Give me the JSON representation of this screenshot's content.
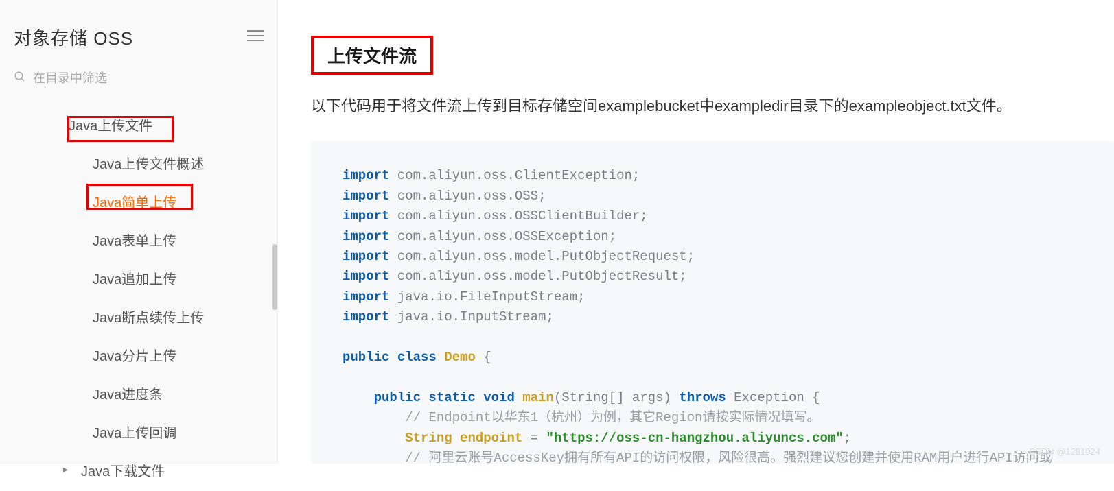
{
  "sidebar": {
    "title": "对象存储 OSS",
    "search_placeholder": "在目录中筛选",
    "items": [
      {
        "label": "Java上传文件",
        "class": "nav-item"
      },
      {
        "label": "Java上传文件概述",
        "class": "nav-item sub"
      },
      {
        "label": "Java简单上传",
        "class": "nav-item sub active"
      },
      {
        "label": "Java表单上传",
        "class": "nav-item sub"
      },
      {
        "label": "Java追加上传",
        "class": "nav-item sub"
      },
      {
        "label": "Java断点续传上传",
        "class": "nav-item sub"
      },
      {
        "label": "Java分片上传",
        "class": "nav-item sub"
      },
      {
        "label": "Java进度条",
        "class": "nav-item sub"
      },
      {
        "label": "Java上传回调",
        "class": "nav-item sub"
      },
      {
        "label": "Java下载文件",
        "class": "nav-item download"
      }
    ]
  },
  "content": {
    "heading": "上传文件流",
    "description": "以下代码用于将文件流上传到目标存储空间examplebucket中exampledir目录下的exampleobject.txt文件。",
    "code": {
      "imports": [
        "com.aliyun.oss.ClientException",
        "com.aliyun.oss.OSS",
        "com.aliyun.oss.OSSClientBuilder",
        "com.aliyun.oss.OSSException",
        "com.aliyun.oss.model.PutObjectRequest",
        "com.aliyun.oss.model.PutObjectResult",
        "java.io.FileInputStream",
        "java.io.InputStream"
      ],
      "class_name": "Demo",
      "method_sig": {
        "kw1": "public static void",
        "name": "main",
        "args": "String[] args",
        "throws": "Exception"
      },
      "comment1": "// Endpoint以华东1（杭州）为例，其它Region请按实际情况填写。",
      "endpoint_var": "String",
      "endpoint_name": "endpoint",
      "endpoint_val": "\"https://oss-cn-hangzhou.aliyuncs.com\"",
      "comment2": "// 阿里云账号AccessKey拥有所有API的访问权限，风险很高。强烈建议您创建并使用RAM用户进行API访问或"
    }
  },
  "watermark": "CSDN @1281024"
}
